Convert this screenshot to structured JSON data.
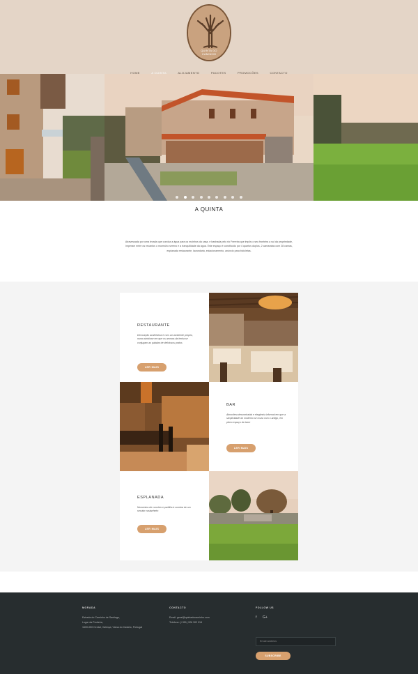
{
  "header": {
    "logo_line1": "QUINTA DO",
    "logo_line2": "CAMINHO",
    "nav": [
      "Home",
      "A Quinta",
      "Alojamento",
      "Pacotes",
      "Promoções",
      "Contacto"
    ],
    "active_nav": "A Quinta"
  },
  "hero": {
    "slide_count": 9,
    "active_slide": 1
  },
  "intro": {
    "title": "A QUINTA",
    "text": "Atravessada por uma levada que conduz a água para os moinhos da casa, e banhada pelo rio Ferreira que impôs o seu fronteira a sul da propriedade, imperam entre os recantos o murmúrio sereno e a tranquilidade da água. Este espaço é constituído por 4 quartos duplos, 2 camaratas com 28 camas, esplanada restaurante, lavandaria, estacionamento, anúncio para bicicletas."
  },
  "sections": [
    {
      "title": "Restaurante",
      "text": "Decoração acolhedora e com um ambiente próprio, numa simbiose em que os aromas da lenha se conjugam ao paladar de deliciosos pratos",
      "button": "Ler mais"
    },
    {
      "title": "Bar",
      "text": "Atmosfera descontraída e elegância informal em que a simplicidade do moderno se cruza com o antigo, em pleno espaço de lazer",
      "button": "Ler mais"
    },
    {
      "title": "Esplanada",
      "text": "Momentos de convívio e partilha à sombra de um secular castanheiro",
      "button": "Ler mais"
    }
  ],
  "footer": {
    "morada": {
      "title": "Morada",
      "lines": [
        "Estrada do Caminho de Santiago,",
        "Lugar da Pedreira,",
        "1600-050 Cerdal, Valença, Viana do Castelo, Portugal"
      ]
    },
    "contacto": {
      "title": "Contacto",
      "lines": [
        "Email: geral@quintadocaminho.com",
        "Telefone: (+351) 926 302 018"
      ]
    },
    "follow": {
      "title": "Follow us",
      "facebook": "f",
      "google": "G+"
    },
    "newsletter": {
      "placeholder": "Email address",
      "button": "Subscribe"
    }
  },
  "colors": {
    "header_bg": "#e4d5c7",
    "accent": "#d7a06e",
    "footer_bg": "#272d2f",
    "section_bg": "#f4f4f4"
  }
}
